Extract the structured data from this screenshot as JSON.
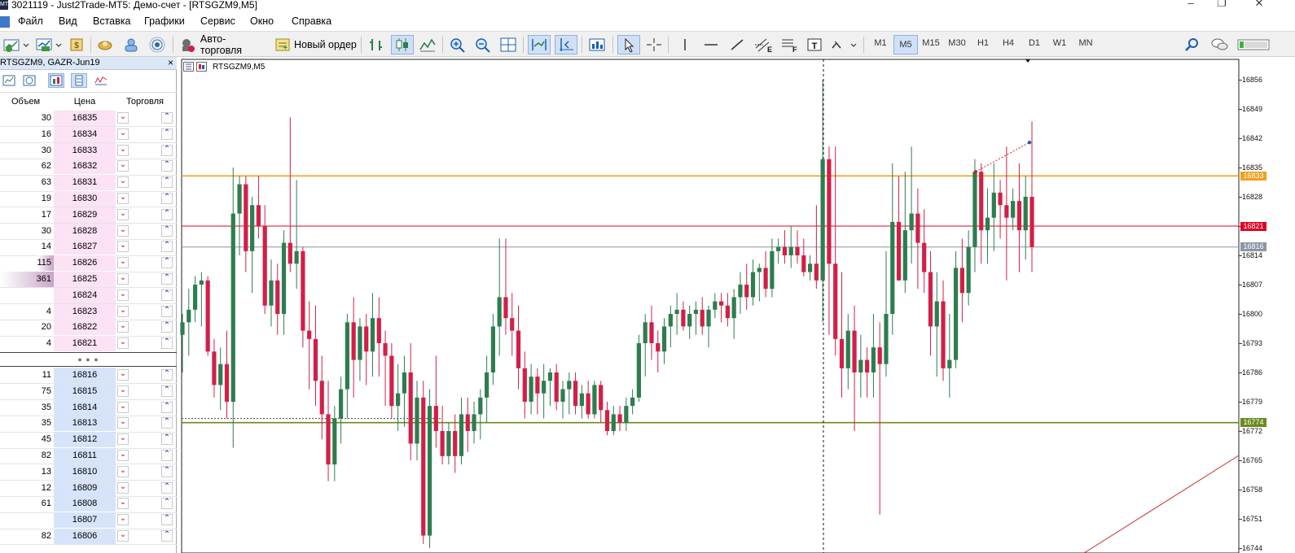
{
  "window": {
    "title": "3021119 - Just2Trade-MT5: Демо-счет - [RTSGZM9,M5]",
    "controls": [
      "‒",
      "❐",
      "✕"
    ]
  },
  "menu": [
    "Файл",
    "Вид",
    "Вставка",
    "Графики",
    "Сервис",
    "Окно",
    "Справка"
  ],
  "toolbar": {
    "autotrade_label": "Авто-торговля",
    "neworder_label": "Новый ордер",
    "timeframes": [
      "M1",
      "M5",
      "M15",
      "M30",
      "H1",
      "H4",
      "D1",
      "W1",
      "MN"
    ],
    "active_timeframe": "M5"
  },
  "dom": {
    "title": "RTSGZM9, GAZR-Jun19",
    "close": "×",
    "columns": {
      "volume": "Объем",
      "price": "Цена",
      "trade": "Торговля"
    },
    "dots": "● ● ●",
    "ask_rows": [
      {
        "vol": "30",
        "price": "16835"
      },
      {
        "vol": "16",
        "price": "16834"
      },
      {
        "vol": "30",
        "price": "16833"
      },
      {
        "vol": "62",
        "price": "16832"
      },
      {
        "vol": "63",
        "price": "16831"
      },
      {
        "vol": "19",
        "price": "16830"
      },
      {
        "vol": "17",
        "price": "16829"
      },
      {
        "vol": "30",
        "price": "16828"
      },
      {
        "vol": "14",
        "price": "16827"
      },
      {
        "vol": "115",
        "price": "16826"
      },
      {
        "vol": "361",
        "price": "16825"
      },
      {
        "vol": "",
        "price": "16824"
      },
      {
        "vol": "4",
        "price": "16823"
      },
      {
        "vol": "20",
        "price": "16822"
      },
      {
        "vol": "4",
        "price": "16821"
      }
    ],
    "bid_rows": [
      {
        "vol": "11",
        "price": "16816"
      },
      {
        "vol": "75",
        "price": "16815"
      },
      {
        "vol": "35",
        "price": "16814"
      },
      {
        "vol": "35",
        "price": "16813"
      },
      {
        "vol": "45",
        "price": "16812"
      },
      {
        "vol": "82",
        "price": "16811"
      },
      {
        "vol": "13",
        "price": "16810"
      },
      {
        "vol": "12",
        "price": "16809"
      },
      {
        "vol": "61",
        "price": "16808"
      },
      {
        "vol": "",
        "price": "16807"
      },
      {
        "vol": "82",
        "price": "16806"
      }
    ]
  },
  "chart": {
    "symbol_label": "RTSGZM9,M5",
    "price_labels": [
      "16856",
      "16849",
      "16842",
      "16835",
      "16828",
      "16821",
      "16814",
      "16807",
      "16800",
      "16793",
      "16786",
      "16779",
      "16772",
      "16765",
      "16758",
      "16751",
      "16744"
    ],
    "levels": [
      {
        "price": 16833,
        "label": "16833",
        "color": "#f0a020"
      },
      {
        "price": 16821,
        "label": "16821",
        "color": "#e00020"
      },
      {
        "price": 16816,
        "label": "16816",
        "color": "#8a96a6"
      },
      {
        "price": 16774,
        "label": "16774",
        "color": "#6a8a20"
      }
    ],
    "colors": {
      "bull": "#2e7d4f",
      "bear": "#d11f48"
    }
  },
  "chart_data": {
    "type": "candlestick",
    "symbol": "RTSGZM9",
    "timeframe": "M5",
    "ylim": [
      16744,
      16858
    ],
    "candles": [
      {
        "o": 16795,
        "h": 16800,
        "l": 16786,
        "c": 16798
      },
      {
        "o": 16798,
        "h": 16806,
        "l": 16790,
        "c": 16801
      },
      {
        "o": 16801,
        "h": 16809,
        "l": 16798,
        "c": 16807
      },
      {
        "o": 16807,
        "h": 16810,
        "l": 16797,
        "c": 16808
      },
      {
        "o": 16808,
        "h": 16809,
        "l": 16790,
        "c": 16791
      },
      {
        "o": 16791,
        "h": 16794,
        "l": 16780,
        "c": 16783
      },
      {
        "o": 16783,
        "h": 16792,
        "l": 16777,
        "c": 16788
      },
      {
        "o": 16788,
        "h": 16796,
        "l": 16775,
        "c": 16779
      },
      {
        "o": 16779,
        "h": 16835,
        "l": 16768,
        "c": 16824
      },
      {
        "o": 16824,
        "h": 16833,
        "l": 16814,
        "c": 16831
      },
      {
        "o": 16831,
        "h": 16833,
        "l": 16810,
        "c": 16815
      },
      {
        "o": 16815,
        "h": 16828,
        "l": 16805,
        "c": 16826
      },
      {
        "o": 16826,
        "h": 16833,
        "l": 16818,
        "c": 16821
      },
      {
        "o": 16821,
        "h": 16826,
        "l": 16800,
        "c": 16802
      },
      {
        "o": 16802,
        "h": 16813,
        "l": 16797,
        "c": 16808
      },
      {
        "o": 16808,
        "h": 16812,
        "l": 16795,
        "c": 16800
      },
      {
        "o": 16800,
        "h": 16820,
        "l": 16795,
        "c": 16817
      },
      {
        "o": 16817,
        "h": 16847,
        "l": 16810,
        "c": 16812
      },
      {
        "o": 16812,
        "h": 16832,
        "l": 16806,
        "c": 16815
      },
      {
        "o": 16815,
        "h": 16816,
        "l": 16792,
        "c": 16796
      },
      {
        "o": 16796,
        "h": 16803,
        "l": 16782,
        "c": 16794
      },
      {
        "o": 16794,
        "h": 16802,
        "l": 16778,
        "c": 16784
      },
      {
        "o": 16784,
        "h": 16790,
        "l": 16770,
        "c": 16776
      },
      {
        "o": 16776,
        "h": 16784,
        "l": 16760,
        "c": 16764
      },
      {
        "o": 16764,
        "h": 16778,
        "l": 16760,
        "c": 16775
      },
      {
        "o": 16775,
        "h": 16785,
        "l": 16769,
        "c": 16782
      },
      {
        "o": 16782,
        "h": 16800,
        "l": 16775,
        "c": 16798
      },
      {
        "o": 16798,
        "h": 16804,
        "l": 16780,
        "c": 16789
      },
      {
        "o": 16789,
        "h": 16799,
        "l": 16784,
        "c": 16797
      },
      {
        "o": 16797,
        "h": 16800,
        "l": 16783,
        "c": 16791
      },
      {
        "o": 16791,
        "h": 16805,
        "l": 16785,
        "c": 16799
      },
      {
        "o": 16799,
        "h": 16804,
        "l": 16785,
        "c": 16793
      },
      {
        "o": 16793,
        "h": 16796,
        "l": 16778,
        "c": 16790
      },
      {
        "o": 16790,
        "h": 16793,
        "l": 16775,
        "c": 16778
      },
      {
        "o": 16778,
        "h": 16788,
        "l": 16772,
        "c": 16781
      },
      {
        "o": 16781,
        "h": 16790,
        "l": 16773,
        "c": 16786
      },
      {
        "o": 16786,
        "h": 16793,
        "l": 16765,
        "c": 16769
      },
      {
        "o": 16769,
        "h": 16784,
        "l": 16765,
        "c": 16780
      },
      {
        "o": 16780,
        "h": 16784,
        "l": 16745,
        "c": 16747
      },
      {
        "o": 16747,
        "h": 16782,
        "l": 16744,
        "c": 16778
      },
      {
        "o": 16778,
        "h": 16790,
        "l": 16768,
        "c": 16772
      },
      {
        "o": 16772,
        "h": 16778,
        "l": 16764,
        "c": 16766
      },
      {
        "o": 16766,
        "h": 16774,
        "l": 16764,
        "c": 16772
      },
      {
        "o": 16772,
        "h": 16776,
        "l": 16762,
        "c": 16766
      },
      {
        "o": 16766,
        "h": 16780,
        "l": 16764,
        "c": 16776
      },
      {
        "o": 16776,
        "h": 16780,
        "l": 16767,
        "c": 16772
      },
      {
        "o": 16772,
        "h": 16779,
        "l": 16769,
        "c": 16776
      },
      {
        "o": 16776,
        "h": 16782,
        "l": 16770,
        "c": 16780
      },
      {
        "o": 16780,
        "h": 16790,
        "l": 16774,
        "c": 16786
      },
      {
        "o": 16786,
        "h": 16800,
        "l": 16783,
        "c": 16797
      },
      {
        "o": 16797,
        "h": 16818,
        "l": 16790,
        "c": 16804
      },
      {
        "o": 16804,
        "h": 16818,
        "l": 16795,
        "c": 16799
      },
      {
        "o": 16799,
        "h": 16805,
        "l": 16790,
        "c": 16796
      },
      {
        "o": 16796,
        "h": 16802,
        "l": 16782,
        "c": 16787
      },
      {
        "o": 16787,
        "h": 16791,
        "l": 16775,
        "c": 16779
      },
      {
        "o": 16779,
        "h": 16788,
        "l": 16776,
        "c": 16785
      },
      {
        "o": 16785,
        "h": 16787,
        "l": 16776,
        "c": 16781
      },
      {
        "o": 16781,
        "h": 16788,
        "l": 16775,
        "c": 16784
      },
      {
        "o": 16784,
        "h": 16787,
        "l": 16778,
        "c": 16786
      },
      {
        "o": 16786,
        "h": 16788,
        "l": 16777,
        "c": 16779
      },
      {
        "o": 16779,
        "h": 16784,
        "l": 16775,
        "c": 16782
      },
      {
        "o": 16782,
        "h": 16786,
        "l": 16776,
        "c": 16784
      },
      {
        "o": 16784,
        "h": 16786,
        "l": 16776,
        "c": 16778
      },
      {
        "o": 16778,
        "h": 16783,
        "l": 16775,
        "c": 16781
      },
      {
        "o": 16781,
        "h": 16784,
        "l": 16775,
        "c": 16776
      },
      {
        "o": 16776,
        "h": 16784,
        "l": 16775,
        "c": 16783
      },
      {
        "o": 16783,
        "h": 16784,
        "l": 16774,
        "c": 16777
      },
      {
        "o": 16777,
        "h": 16779,
        "l": 16771,
        "c": 16772
      },
      {
        "o": 16772,
        "h": 16778,
        "l": 16771,
        "c": 16776
      },
      {
        "o": 16776,
        "h": 16778,
        "l": 16772,
        "c": 16774
      },
      {
        "o": 16774,
        "h": 16780,
        "l": 16772,
        "c": 16778
      },
      {
        "o": 16778,
        "h": 16782,
        "l": 16776,
        "c": 16780
      },
      {
        "o": 16780,
        "h": 16795,
        "l": 16779,
        "c": 16793
      },
      {
        "o": 16793,
        "h": 16800,
        "l": 16785,
        "c": 16798
      },
      {
        "o": 16798,
        "h": 16802,
        "l": 16789,
        "c": 16793
      },
      {
        "o": 16793,
        "h": 16796,
        "l": 16786,
        "c": 16791
      },
      {
        "o": 16791,
        "h": 16799,
        "l": 16788,
        "c": 16797
      },
      {
        "o": 16797,
        "h": 16802,
        "l": 16792,
        "c": 16800
      },
      {
        "o": 16800,
        "h": 16805,
        "l": 16795,
        "c": 16801
      },
      {
        "o": 16801,
        "h": 16803,
        "l": 16796,
        "c": 16797
      },
      {
        "o": 16797,
        "h": 16802,
        "l": 16794,
        "c": 16800
      },
      {
        "o": 16800,
        "h": 16803,
        "l": 16795,
        "c": 16801
      },
      {
        "o": 16801,
        "h": 16804,
        "l": 16795,
        "c": 16797
      },
      {
        "o": 16797,
        "h": 16802,
        "l": 16792,
        "c": 16801
      },
      {
        "o": 16801,
        "h": 16805,
        "l": 16799,
        "c": 16803
      },
      {
        "o": 16803,
        "h": 16805,
        "l": 16798,
        "c": 16802
      },
      {
        "o": 16802,
        "h": 16805,
        "l": 16797,
        "c": 16799
      },
      {
        "o": 16799,
        "h": 16806,
        "l": 16794,
        "c": 16804
      },
      {
        "o": 16804,
        "h": 16810,
        "l": 16800,
        "c": 16807
      },
      {
        "o": 16807,
        "h": 16812,
        "l": 16801,
        "c": 16804
      },
      {
        "o": 16804,
        "h": 16813,
        "l": 16802,
        "c": 16810
      },
      {
        "o": 16810,
        "h": 16812,
        "l": 16803,
        "c": 16811
      },
      {
        "o": 16811,
        "h": 16815,
        "l": 16804,
        "c": 16806
      },
      {
        "o": 16806,
        "h": 16818,
        "l": 16804,
        "c": 16815
      },
      {
        "o": 16815,
        "h": 16818,
        "l": 16812,
        "c": 16816
      },
      {
        "o": 16816,
        "h": 16820,
        "l": 16812,
        "c": 16814
      },
      {
        "o": 16814,
        "h": 16821,
        "l": 16811,
        "c": 16816
      },
      {
        "o": 16816,
        "h": 16820,
        "l": 16812,
        "c": 16814
      },
      {
        "o": 16814,
        "h": 16818,
        "l": 16809,
        "c": 16810
      },
      {
        "o": 16810,
        "h": 16814,
        "l": 16808,
        "c": 16812
      },
      {
        "o": 16812,
        "h": 16826,
        "l": 16806,
        "c": 16808
      },
      {
        "o": 16808,
        "h": 16856,
        "l": 16798,
        "c": 16837
      },
      {
        "o": 16837,
        "h": 16840,
        "l": 16795,
        "c": 16812
      },
      {
        "o": 16812,
        "h": 16840,
        "l": 16790,
        "c": 16794
      },
      {
        "o": 16794,
        "h": 16810,
        "l": 16780,
        "c": 16787
      },
      {
        "o": 16787,
        "h": 16800,
        "l": 16782,
        "c": 16796
      },
      {
        "o": 16796,
        "h": 16802,
        "l": 16772,
        "c": 16786
      },
      {
        "o": 16786,
        "h": 16795,
        "l": 16780,
        "c": 16789
      },
      {
        "o": 16789,
        "h": 16792,
        "l": 16780,
        "c": 16786
      },
      {
        "o": 16786,
        "h": 16800,
        "l": 16780,
        "c": 16792
      },
      {
        "o": 16792,
        "h": 16798,
        "l": 16752,
        "c": 16788
      },
      {
        "o": 16788,
        "h": 16815,
        "l": 16785,
        "c": 16800
      },
      {
        "o": 16800,
        "h": 16836,
        "l": 16795,
        "c": 16822
      },
      {
        "o": 16822,
        "h": 16833,
        "l": 16810,
        "c": 16808
      },
      {
        "o": 16808,
        "h": 16834,
        "l": 16805,
        "c": 16820
      },
      {
        "o": 16820,
        "h": 16840,
        "l": 16812,
        "c": 16824
      },
      {
        "o": 16824,
        "h": 16830,
        "l": 16806,
        "c": 16817
      },
      {
        "o": 16817,
        "h": 16825,
        "l": 16805,
        "c": 16810
      },
      {
        "o": 16810,
        "h": 16815,
        "l": 16790,
        "c": 16797
      },
      {
        "o": 16797,
        "h": 16810,
        "l": 16785,
        "c": 16803
      },
      {
        "o": 16803,
        "h": 16808,
        "l": 16784,
        "c": 16787
      },
      {
        "o": 16787,
        "h": 16800,
        "l": 16780,
        "c": 16789
      },
      {
        "o": 16789,
        "h": 16815,
        "l": 16787,
        "c": 16811
      },
      {
        "o": 16811,
        "h": 16818,
        "l": 16798,
        "c": 16805
      },
      {
        "o": 16805,
        "h": 16820,
        "l": 16802,
        "c": 16816
      },
      {
        "o": 16816,
        "h": 16837,
        "l": 16810,
        "c": 16834
      },
      {
        "o": 16834,
        "h": 16836,
        "l": 16812,
        "c": 16820
      },
      {
        "o": 16820,
        "h": 16830,
        "l": 16812,
        "c": 16823
      },
      {
        "o": 16823,
        "h": 16836,
        "l": 16815,
        "c": 16829
      },
      {
        "o": 16829,
        "h": 16832,
        "l": 16818,
        "c": 16826
      },
      {
        "o": 16826,
        "h": 16840,
        "l": 16808,
        "c": 16823
      },
      {
        "o": 16823,
        "h": 16830,
        "l": 16820,
        "c": 16827
      },
      {
        "o": 16827,
        "h": 16836,
        "l": 16810,
        "c": 16820
      },
      {
        "o": 16820,
        "h": 16833,
        "l": 16813,
        "c": 16828
      },
      {
        "o": 16828,
        "h": 16846,
        "l": 16810,
        "c": 16816
      }
    ]
  }
}
